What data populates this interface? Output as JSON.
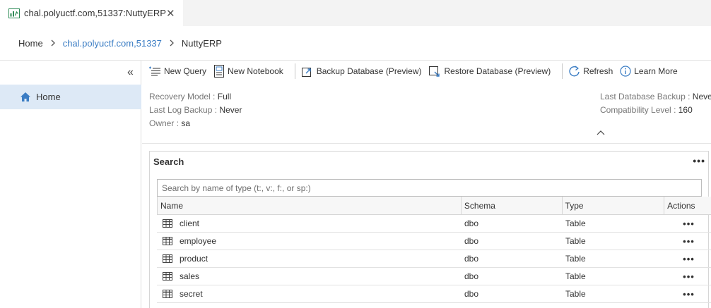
{
  "tab": {
    "title": "chal.polyuctf.com,51337:NuttyERP",
    "close_glyph": "✕"
  },
  "breadcrumb": {
    "home": "Home",
    "server": "chal.polyuctf.com,51337",
    "database": "NuttyERP"
  },
  "sidebar": {
    "collapse_glyph": "«",
    "home_label": "Home"
  },
  "toolbar": {
    "new_query": "New Query",
    "new_notebook": "New Notebook",
    "backup": "Backup Database (Preview)",
    "restore": "Restore Database (Preview)",
    "refresh": "Refresh",
    "learn_more": "Learn More"
  },
  "properties": {
    "recovery_model": {
      "key": "Recovery Model",
      "value": "Full"
    },
    "last_log_backup": {
      "key": "Last Log Backup",
      "value": "Never"
    },
    "owner": {
      "key": "Owner",
      "value": "sa"
    },
    "last_db_backup": {
      "key": "Last Database Backup",
      "value": "Neve"
    },
    "compat_level": {
      "key": "Compatibility Level",
      "value": "160"
    },
    "separator": ":"
  },
  "search": {
    "title": "Search",
    "more": "•••",
    "placeholder": "Search by name of type (t:, v:, f:, or sp:)"
  },
  "grid": {
    "headers": {
      "name": "Name",
      "schema": "Schema",
      "type": "Type",
      "actions": "Actions"
    },
    "rows": [
      {
        "name": "client",
        "schema": "dbo",
        "type": "Table",
        "actions": "•••"
      },
      {
        "name": "employee",
        "schema": "dbo",
        "type": "Table",
        "actions": "•••"
      },
      {
        "name": "product",
        "schema": "dbo",
        "type": "Table",
        "actions": "•••"
      },
      {
        "name": "sales",
        "schema": "dbo",
        "type": "Table",
        "actions": "•••"
      },
      {
        "name": "secret",
        "schema": "dbo",
        "type": "Table",
        "actions": "•••"
      }
    ]
  },
  "colors": {
    "accent": "#3b7dc4",
    "selected": "#dde9f6",
    "icon_green": "#2e8b57"
  }
}
